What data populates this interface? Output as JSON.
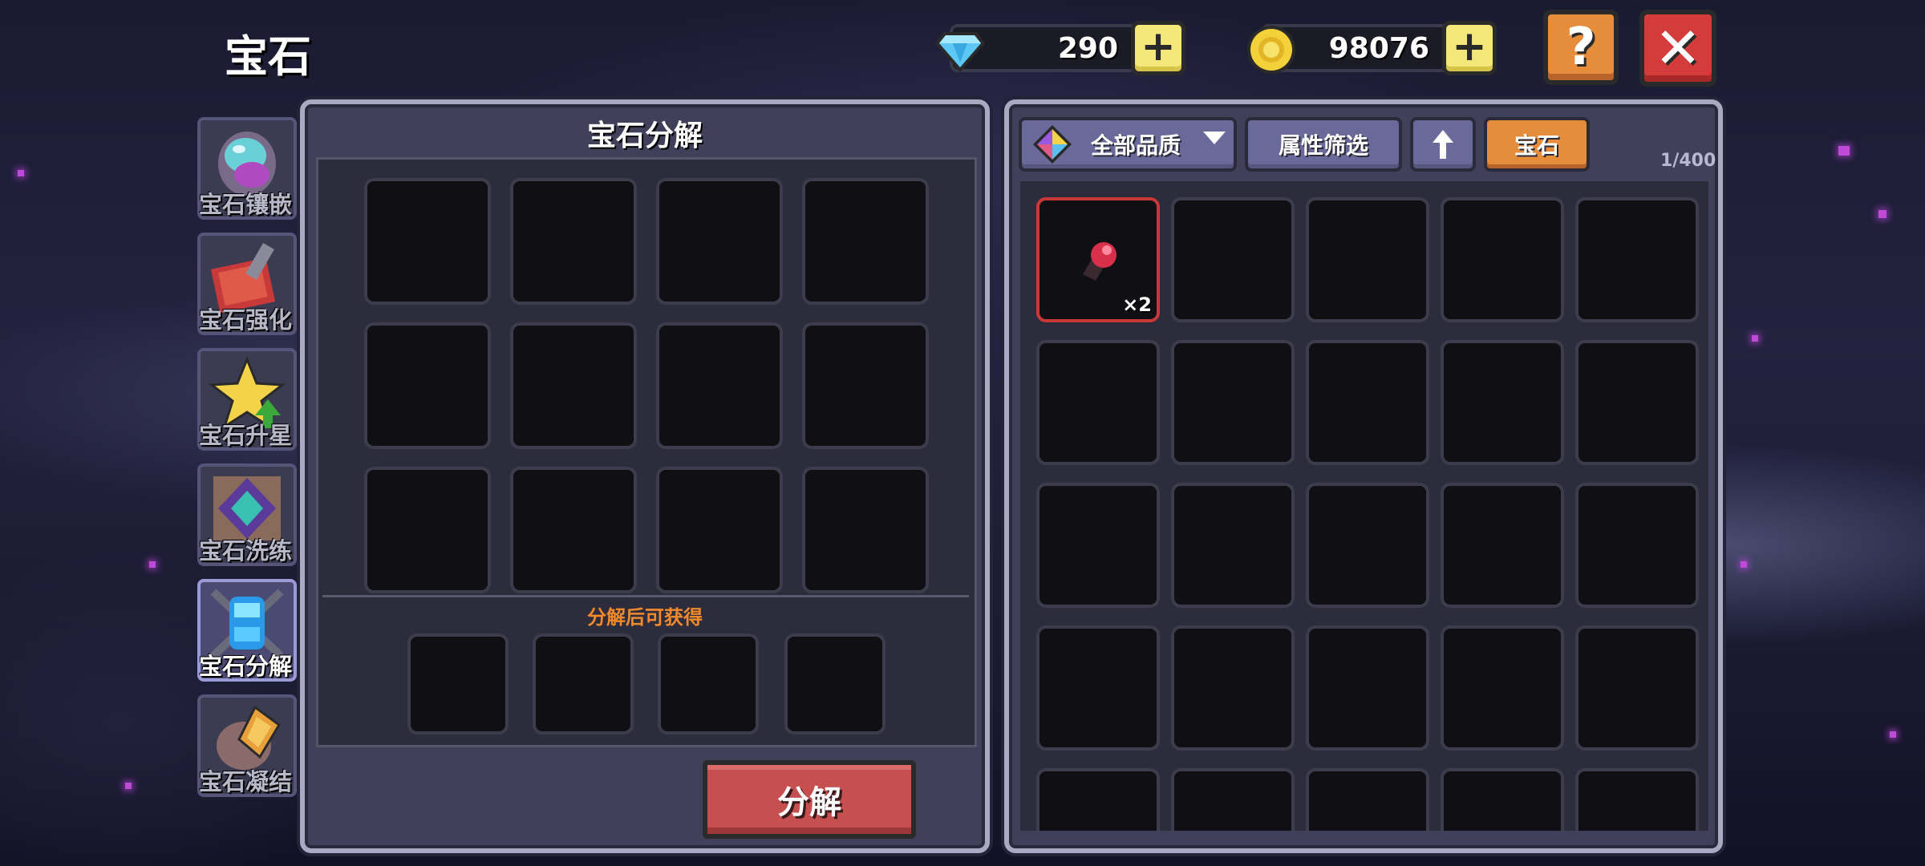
{
  "header": {
    "title": "宝石",
    "gems": "290",
    "gold": "98076"
  },
  "tabs": [
    {
      "label": "宝石镶嵌",
      "icon": "gem-inlay-icon",
      "active": false
    },
    {
      "label": "宝石强化",
      "icon": "gem-enhance-icon",
      "active": false
    },
    {
      "label": "宝石升星",
      "icon": "gem-star-up-icon",
      "active": false
    },
    {
      "label": "宝石洗练",
      "icon": "gem-refine-icon",
      "active": false
    },
    {
      "label": "宝石分解",
      "icon": "gem-decompose-icon",
      "active": true
    },
    {
      "label": "宝石凝结",
      "icon": "gem-condense-icon",
      "active": false
    }
  ],
  "left_panel": {
    "title": "宝石分解",
    "reward_label": "分解后可获得",
    "decompose_button": "分解"
  },
  "right_panel": {
    "quality_filter": "全部品质",
    "attribute_filter": "属性筛选",
    "category": "宝石",
    "capacity": "1/400",
    "items": [
      {
        "icon": "red-gem-icon",
        "count": "×2",
        "color": "#d8304a"
      }
    ]
  },
  "colors": {
    "accent_orange": "#e58d3b",
    "close_red": "#d43c3c",
    "plus_yellow": "#f3e77a",
    "decompose_red": "#c65050"
  }
}
